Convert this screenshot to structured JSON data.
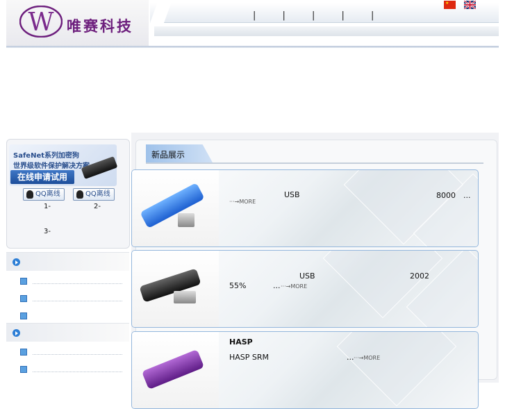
{
  "header": {
    "brand_text": "唯赛科技",
    "logo_letter": "W",
    "nav_separators": "| | | | |",
    "lang_cn": "chinese-flag-icon",
    "lang_en": "english-flag-icon"
  },
  "sidebar": {
    "banner": {
      "line1": "SafeNet系列加密狗",
      "line2": "世界级软件保护解决方案",
      "button": "在线申请试用"
    },
    "qq_buttons": [
      {
        "label": "QQ离线"
      },
      {
        "label": "QQ离线"
      }
    ],
    "contact_labels": [
      "1-",
      "2-",
      "3-"
    ],
    "section_icons": [
      "arrow-circle-icon",
      "arrow-circle-icon"
    ]
  },
  "main": {
    "tab_label": "新品展示",
    "products": [
      {
        "t1": "USB",
        "t2": "8000",
        "t3": "...",
        "more": "···→MORE"
      },
      {
        "t1": "USB",
        "t2": "2002",
        "t3": "55%",
        "t4": "...",
        "more": "···→MORE"
      },
      {
        "t1": "HASP",
        "t2": "HASP SRM",
        "t3": "...",
        "more": "···→MORE"
      }
    ]
  },
  "colors": {
    "brand_purple": "#6d1f7d",
    "accent_blue": "#2e7fd6",
    "card_border": "#93b6dc"
  }
}
